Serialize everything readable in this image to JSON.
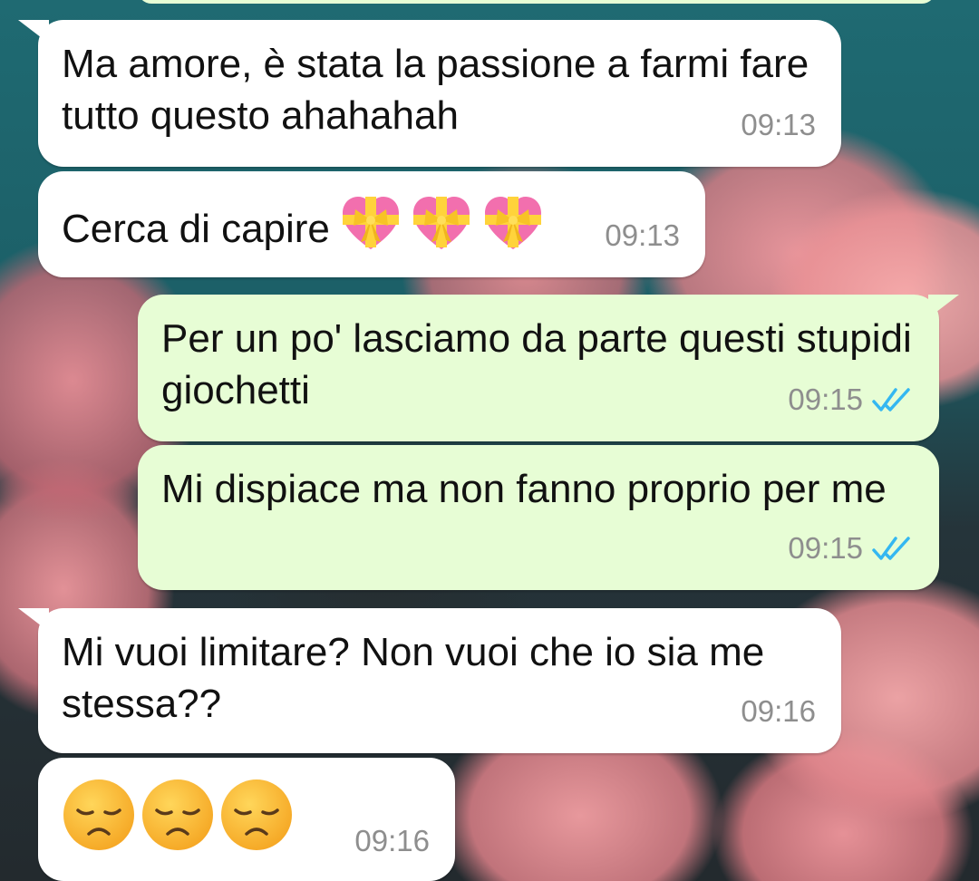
{
  "messages": [
    {
      "direction": "incoming",
      "text": "Ma amore, è stata la passione a farmi fare tutto questo ahahahah",
      "time": "09:13"
    },
    {
      "direction": "incoming",
      "text": "Cerca di capire",
      "emoji": [
        "heart-with-ribbon",
        "heart-with-ribbon",
        "heart-with-ribbon"
      ],
      "time": "09:13"
    },
    {
      "direction": "outgoing",
      "text": "Per un po' lasciamo da parte questi stupidi giochetti",
      "time": "09:15",
      "status": "read"
    },
    {
      "direction": "outgoing",
      "text": "Mi dispiace ma non fanno proprio per me",
      "time": "09:15",
      "status": "read"
    },
    {
      "direction": "incoming",
      "text": "Mi vuoi limitare? Non vuoi che io sia me stessa??",
      "time": "09:16"
    },
    {
      "direction": "incoming",
      "text": "",
      "emoji": [
        "disappointed-face",
        "disappointed-face",
        "disappointed-face"
      ],
      "time": "09:16"
    }
  ],
  "colors": {
    "incoming_bubble": "#ffffff",
    "outgoing_bubble": "#e7fdd5",
    "timestamp": "#8e8e8e",
    "read_ticks": "#34b7f1"
  }
}
